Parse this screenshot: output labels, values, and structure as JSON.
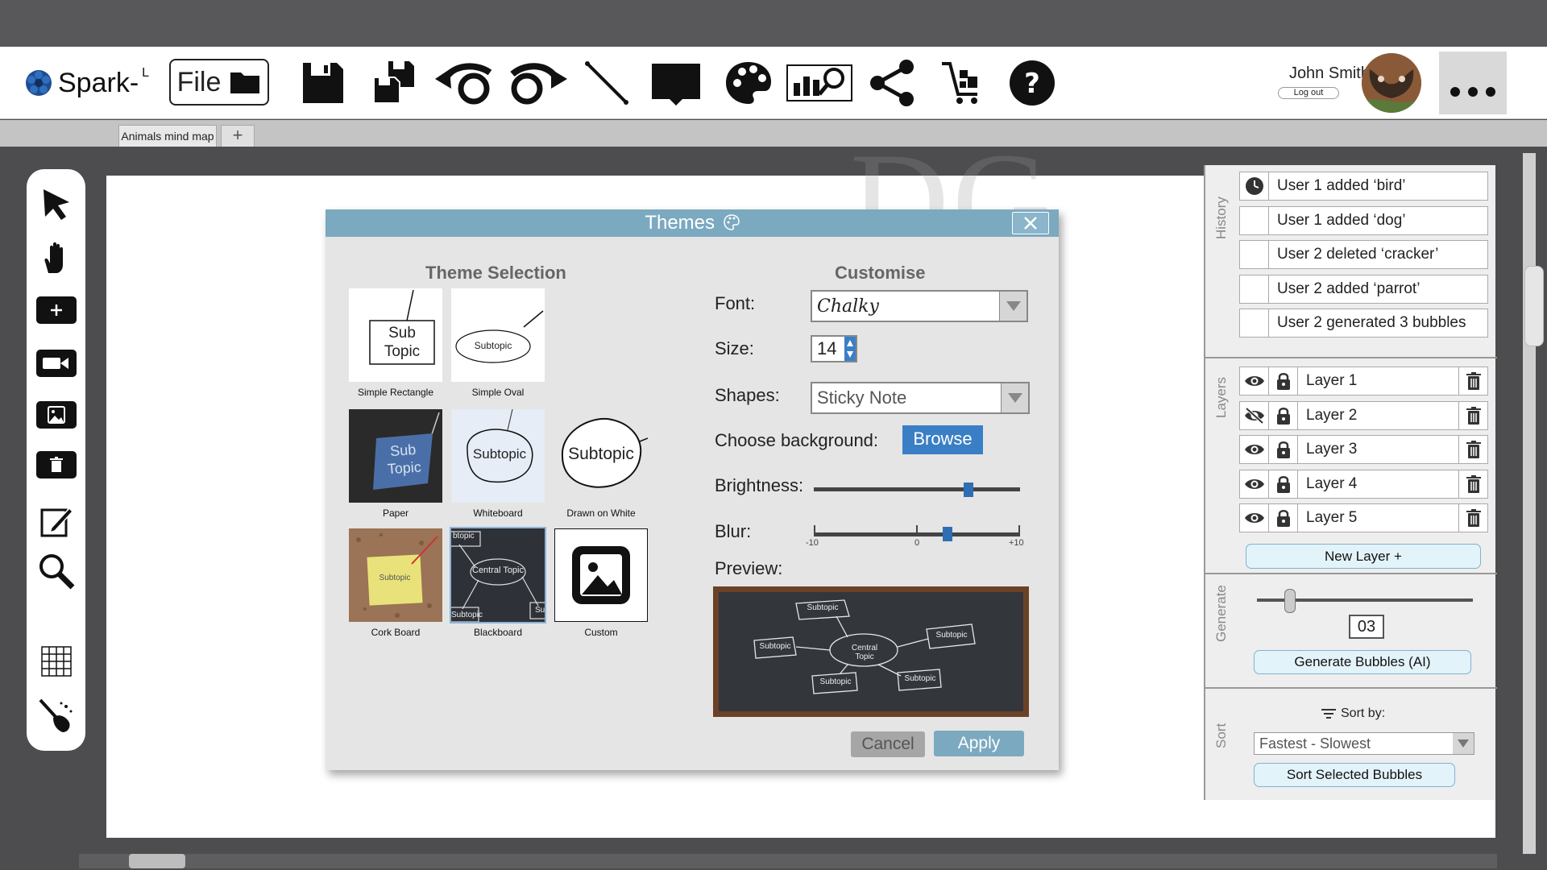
{
  "app": {
    "name": "Spark-",
    "superscript": "L",
    "file_label": "File"
  },
  "user": {
    "name": "John Smith",
    "logout": "Log out"
  },
  "tabs": {
    "active": "Animals mind map",
    "add": "+"
  },
  "watermark": "DG",
  "toolbar": {
    "icons": [
      "save-icon",
      "save-all-icon",
      "undo-icon",
      "redo-icon",
      "line-icon",
      "present-icon",
      "palette-icon",
      "chart-search-icon",
      "share-icon",
      "cart-icon",
      "help-icon"
    ]
  },
  "left_tools": [
    "pointer-icon",
    "hand-icon",
    "add-icon",
    "video-icon",
    "image-icon",
    "delete-icon",
    "edit-icon",
    "zoom-icon",
    "grid-icon",
    "brush-icon"
  ],
  "dialog": {
    "title": "Themes",
    "theme_selection_title": "Theme Selection",
    "customise_title": "Customise",
    "themes": [
      {
        "label": "Simple Rectangle",
        "text": "Sub Topic"
      },
      {
        "label": "Simple Oval",
        "text": "Subtopic"
      },
      {
        "label": "Paper",
        "text": "Sub Topic"
      },
      {
        "label": "Whiteboard",
        "text": "Subtopic"
      },
      {
        "label": "Drawn on White",
        "text": "Subtopic"
      },
      {
        "label": "Cork Board",
        "text": "Subtopic"
      },
      {
        "label": "Blackboard",
        "text": "Central Topic"
      },
      {
        "label": "Custom",
        "text": ""
      }
    ],
    "blackboard_extra": {
      "top_left": "btopic",
      "bottom_left": "Subtopic",
      "bottom_right": "Su"
    },
    "font_label": "Font:",
    "font_value": "Chalky",
    "size_label": "Size:",
    "size_value": "14",
    "shapes_label": "Shapes:",
    "shapes_value": "Sticky Note",
    "background_label": "Choose background:",
    "browse_label": "Browse",
    "brightness_label": "Brightness:",
    "brightness_value": 0.75,
    "blur_label": "Blur:",
    "blur_value": 3,
    "blur_min": "-10",
    "blur_mid": "0",
    "blur_max": "+10",
    "preview_label": "Preview:",
    "preview_nodes": {
      "central": "Central Topic",
      "sub": "Subtopic"
    },
    "cancel_label": "Cancel",
    "apply_label": "Apply"
  },
  "panel": {
    "history_label": "History",
    "history": [
      "User 1 added ‘bird’",
      "User 1 added ‘dog’",
      "User 2 deleted ‘cracker’",
      "User 2 added ‘parrot’",
      "User 2 generated 3 bubbles"
    ],
    "layers_label": "Layers",
    "layers": [
      {
        "name": "Layer 1",
        "visible": true
      },
      {
        "name": "Layer 2",
        "visible": false
      },
      {
        "name": "Layer 3",
        "visible": true
      },
      {
        "name": "Layer 4",
        "visible": true
      },
      {
        "name": "Layer 5",
        "visible": true
      }
    ],
    "new_layer": "New Layer +",
    "generate_label": "Generate",
    "generate_count": "03",
    "generate_button": "Generate Bubbles (AI)",
    "sort_label": "Sort",
    "sort_by": "Sort by:",
    "sort_value": "Fastest - Slowest",
    "sort_button": "Sort Selected Bubbles"
  }
}
